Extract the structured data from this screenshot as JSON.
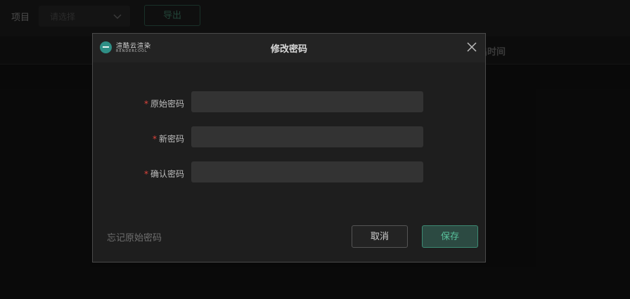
{
  "background": {
    "project_label": "项目",
    "project_select_placeholder": "请选择",
    "export_button": "导出",
    "column_time": "出时间"
  },
  "dialog": {
    "logo_text_cn": "渲酷云渲染",
    "logo_text_en": "RENDERCOOL",
    "title": "修改密码",
    "fields": [
      {
        "label": "原始密码",
        "required": "*",
        "value": ""
      },
      {
        "label": "新密码",
        "required": "*",
        "value": ""
      },
      {
        "label": "确认密码",
        "required": "*",
        "value": ""
      }
    ],
    "forgot_link": "忘记原始密码",
    "cancel_button": "取消",
    "save_button": "保存"
  },
  "colors": {
    "accent": "#3d8a73",
    "required": "#e0443c",
    "background": "#121212"
  }
}
